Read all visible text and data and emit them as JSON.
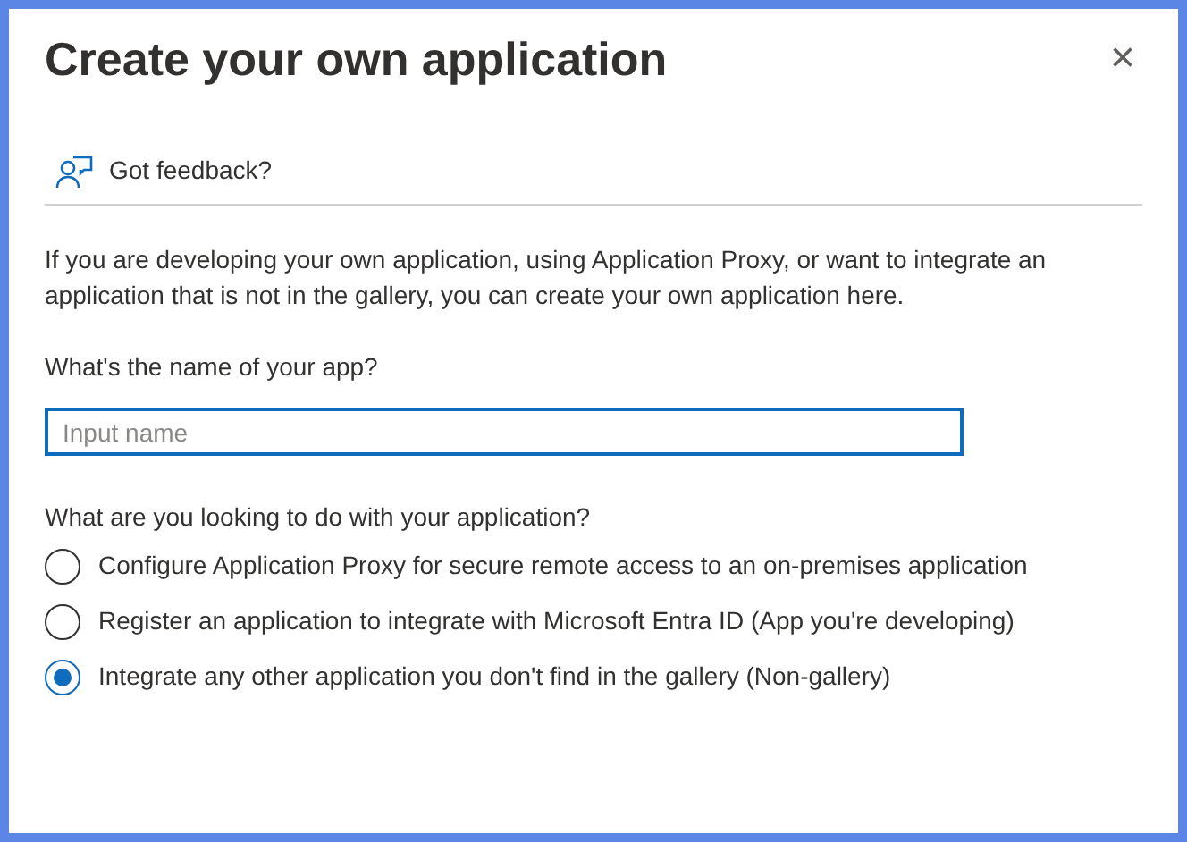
{
  "dialog": {
    "title": "Create your own application",
    "close": "×"
  },
  "feedback": {
    "label": "Got feedback?"
  },
  "description": "If you are developing your own application, using Application Proxy, or want to integrate an application that is not in the gallery, you can create your own application here.",
  "name_field": {
    "label": "What's the name of your app?",
    "placeholder": "Input name",
    "focused": true
  },
  "purpose": {
    "label": "What are you looking to do with your application?",
    "options": [
      {
        "label": "Configure Application Proxy for secure remote access to an on-premises application",
        "selected": false
      },
      {
        "label": "Register an application to integrate with Microsoft Entra ID (App you're developing)",
        "selected": false
      },
      {
        "label": "Integrate any other application you don't find in the gallery (Non-gallery)",
        "selected": true
      }
    ]
  }
}
